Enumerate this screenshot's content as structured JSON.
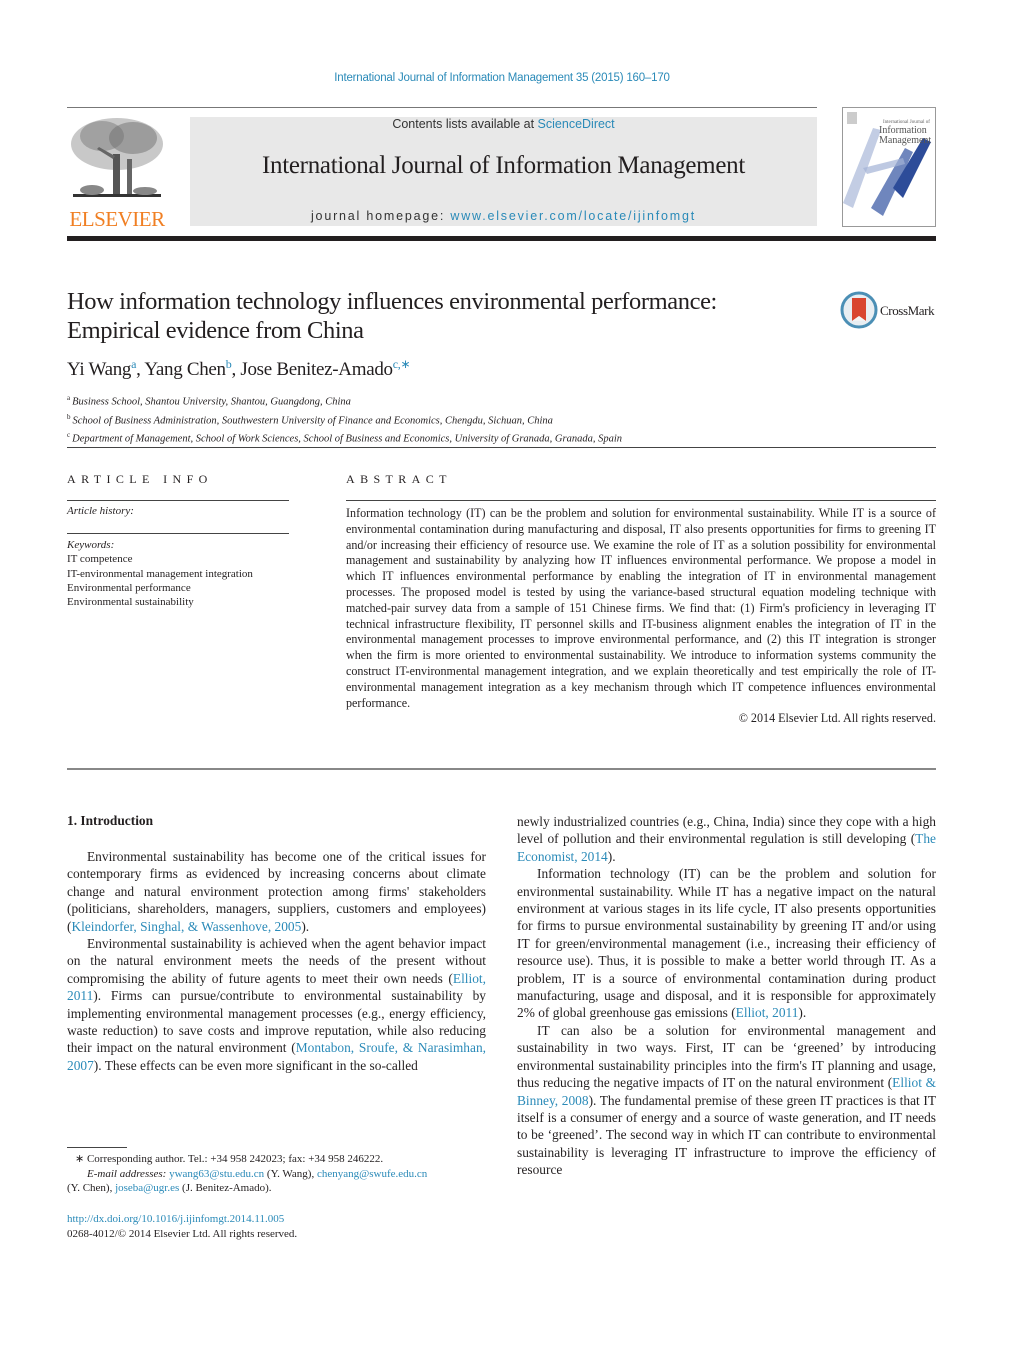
{
  "header": {
    "journal_reference": "International Journal of Information Management 35 (2015) 160–170",
    "contents_prefix": "Contents lists available at ",
    "contents_link": "ScienceDirect",
    "journal_title": "International Journal of Information Management",
    "homepage_prefix": "journal homepage: ",
    "homepage_link": "www.elsevier.com/locate/ijinfomgt",
    "publisher_logo_text": "ELSEVIER",
    "cover": {
      "small_title": "International Journal of",
      "title_line1": "Information",
      "title_line2": "Management"
    },
    "colors": {
      "link": "#2a8ab8",
      "publisher_orange": "#f07f23",
      "band": "#e8e8e8"
    }
  },
  "article": {
    "title_line1": "How information technology influences environmental performance:",
    "title_line2": "Empirical evidence from China",
    "crossmark_label": "CrossMark",
    "authors": [
      {
        "name": "Yi Wang",
        "sup": "a"
      },
      {
        "name": "Yang Chen",
        "sup": "b"
      },
      {
        "name": "Jose Benitez-Amado",
        "sup": "c,∗"
      }
    ],
    "affiliations": [
      {
        "sup": "a",
        "text": "Business School, Shantou University, Shantou, Guangdong, China"
      },
      {
        "sup": "b",
        "text": "School of Business Administration, Southwestern University of Finance and Economics, Chengdu, Sichuan, China"
      },
      {
        "sup": "c",
        "text": "Department of Management, School of Work Sciences, School of Business and Economics, University of Granada, Granada, Spain"
      }
    ]
  },
  "article_info": {
    "heading": "ARTICLE INFO",
    "history_label": "Article history:",
    "keywords_label": "Keywords:",
    "keywords": [
      "IT competence",
      "IT-environmental management integration",
      "Environmental performance",
      "Environmental sustainability"
    ]
  },
  "abstract": {
    "heading": "ABSTRACT",
    "text": "Information technology (IT) can be the problem and solution for environmental sustainability. While IT is a source of environmental contamination during manufacturing and disposal, IT also presents opportunities for firms to greening IT and/or increasing their efficiency of resource use. We examine the role of IT as a solution possibility for environmental management and sustainability by analyzing how IT influences environmental performance. We propose a model in which IT influences environ­mental performance by enabling the integration of IT in environmental management processes. The proposed model is tested by using the variance-based structural equation modeling technique with matched-pair survey data from a sample of 151 Chinese firms. We find that: (1) Firm's proficiency in leveraging IT technical infrastructure flexibility, IT personnel skills and IT-business alignment enables the integration of IT in the environmental management processes to improve environmental performance, and (2) this IT integration is stronger when the firm is more oriented to environmental sustaina­bility. We introduce to information systems community the construct IT-environmental management integration, and we explain theoretically and test empirically the role of IT-environmental management integration as a key mechanism through which IT competence influences environmental performance.",
    "copyright": "© 2014 Elsevier Ltd. All rights reserved."
  },
  "body": {
    "section_heading": "1.  Introduction",
    "left": {
      "p1_text": "Environmental sustainability has become one of the critical issues for contemporary firms as evidenced by increasing concerns about climate change and natural environment protection among firms' stakeholders (politicians, shareholders, managers, suppliers, customers and employees) (",
      "p1_cite": "Kleindorfer, Singhal, & Wassenhove, 2005",
      "p1_end": ").",
      "p2_text": "Environmental sustainability is achieved when the agent behav­ior impact on the natural environment meets the needs of the present without compromising the ability of future agents to meet their own needs (",
      "p2_cite1": "Elliot, 2011",
      "p2_mid": "). Firms can pursue/contribute to environmental sustainability by implementing environmental management processes (e.g., energy efficiency, waste reduction) to save costs and improve reputation, while also reducing their impact on the natural environment (",
      "p2_cite2": "Montabon, Sroufe, & Narasimhan, 2007",
      "p2_end": "). These effects can be even more significant in the so-called"
    },
    "right": {
      "p1_text": "newly industrialized countries (e.g., China, India) since they cope with a high level of pollution and their environmental regulation is still developing (",
      "p1_cite": "The Economist, 2014",
      "p1_end": ").",
      "p2_text": "Information technology (IT) can be the problem and solution for environmental sustainability. While IT has a negative impact on the natural environment at various stages in its life cycle, IT also presents opportunities for firms to pursue environmental sus­tainability by greening IT and/or using IT for green/environmental management (i.e., increasing their efficiency of resource use). Thus, it is possible to make a better world through IT. As a problem, IT is a source of environmental contamination during product manufac­turing, usage and disposal, and it is responsible for approximately 2% of global greenhouse gas emissions (",
      "p2_cite": "Elliot, 2011",
      "p2_end": ").",
      "p3_text": "IT can also be a solution for environmental management and sustainability in two ways. First, IT can be ‘greened’ by introducing environmental sustainability principles into the firm's IT planning and usage, thus reducing the negative impacts of IT on the natural environment (",
      "p3_cite": "Elliot & Binney, 2008",
      "p3_end": "). The fundamental premise of these green IT practices is that IT itself is a consumer of energy and a source of waste generation, and IT needs to be ‘greened’. The sec­ond way in which IT can contribute to environmental sustainability is leveraging IT infrastructure to improve the efficiency of resource"
    }
  },
  "footnotes": {
    "corresponding": "∗  Corresponding author. Tel.: +34 958 242023; fax: +34 958 246222.",
    "email_label": "E-mail addresses:",
    "email1": "ywang63@stu.edu.cn",
    "email1_name": " (Y. Wang), ",
    "email2": "chenyang@swufe.edu.cn",
    "email2_name": "(Y. Chen), ",
    "email3": "joseba@ugr.es",
    "email3_name": " (J. Benitez-Amado).",
    "doi": "http://dx.doi.org/10.1016/j.ijinfomgt.2014.11.005",
    "issn_copyright": "0268-4012/© 2014 Elsevier Ltd. All rights reserved."
  }
}
